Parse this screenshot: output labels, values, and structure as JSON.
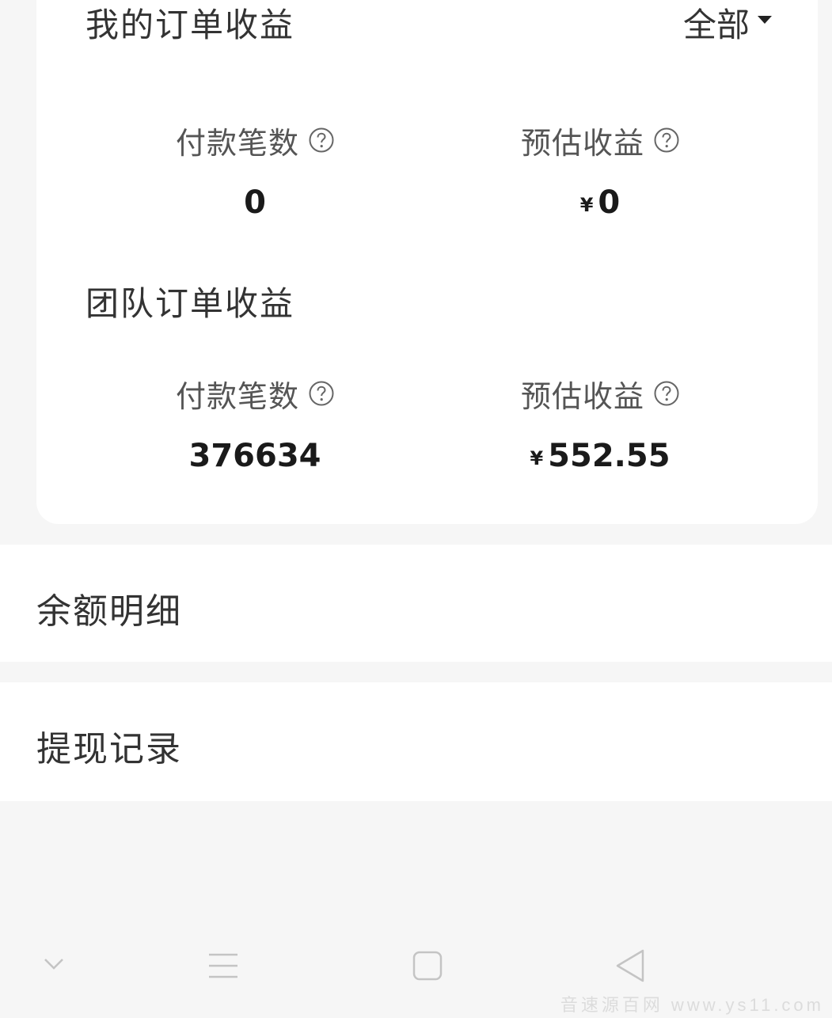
{
  "my_orders": {
    "title": "我的订单收益",
    "filter_label": "全部",
    "count_label": "付款笔数",
    "count_value": "0",
    "earnings_label": "预估收益",
    "currency": "¥",
    "earnings_value": "0"
  },
  "team_orders": {
    "title": "团队订单收益",
    "count_label": "付款笔数",
    "count_value": "376634",
    "earnings_label": "预估收益",
    "currency": "¥",
    "earnings_value": "552.55"
  },
  "menu": {
    "balance_detail": "余额明细",
    "withdraw_record": "提现记录"
  },
  "navbar": {
    "icons": [
      "chevron-down-icon",
      "menu-icon",
      "home-square-icon",
      "back-triangle-icon"
    ]
  },
  "watermark": "音速源百网 www.ys11.com"
}
